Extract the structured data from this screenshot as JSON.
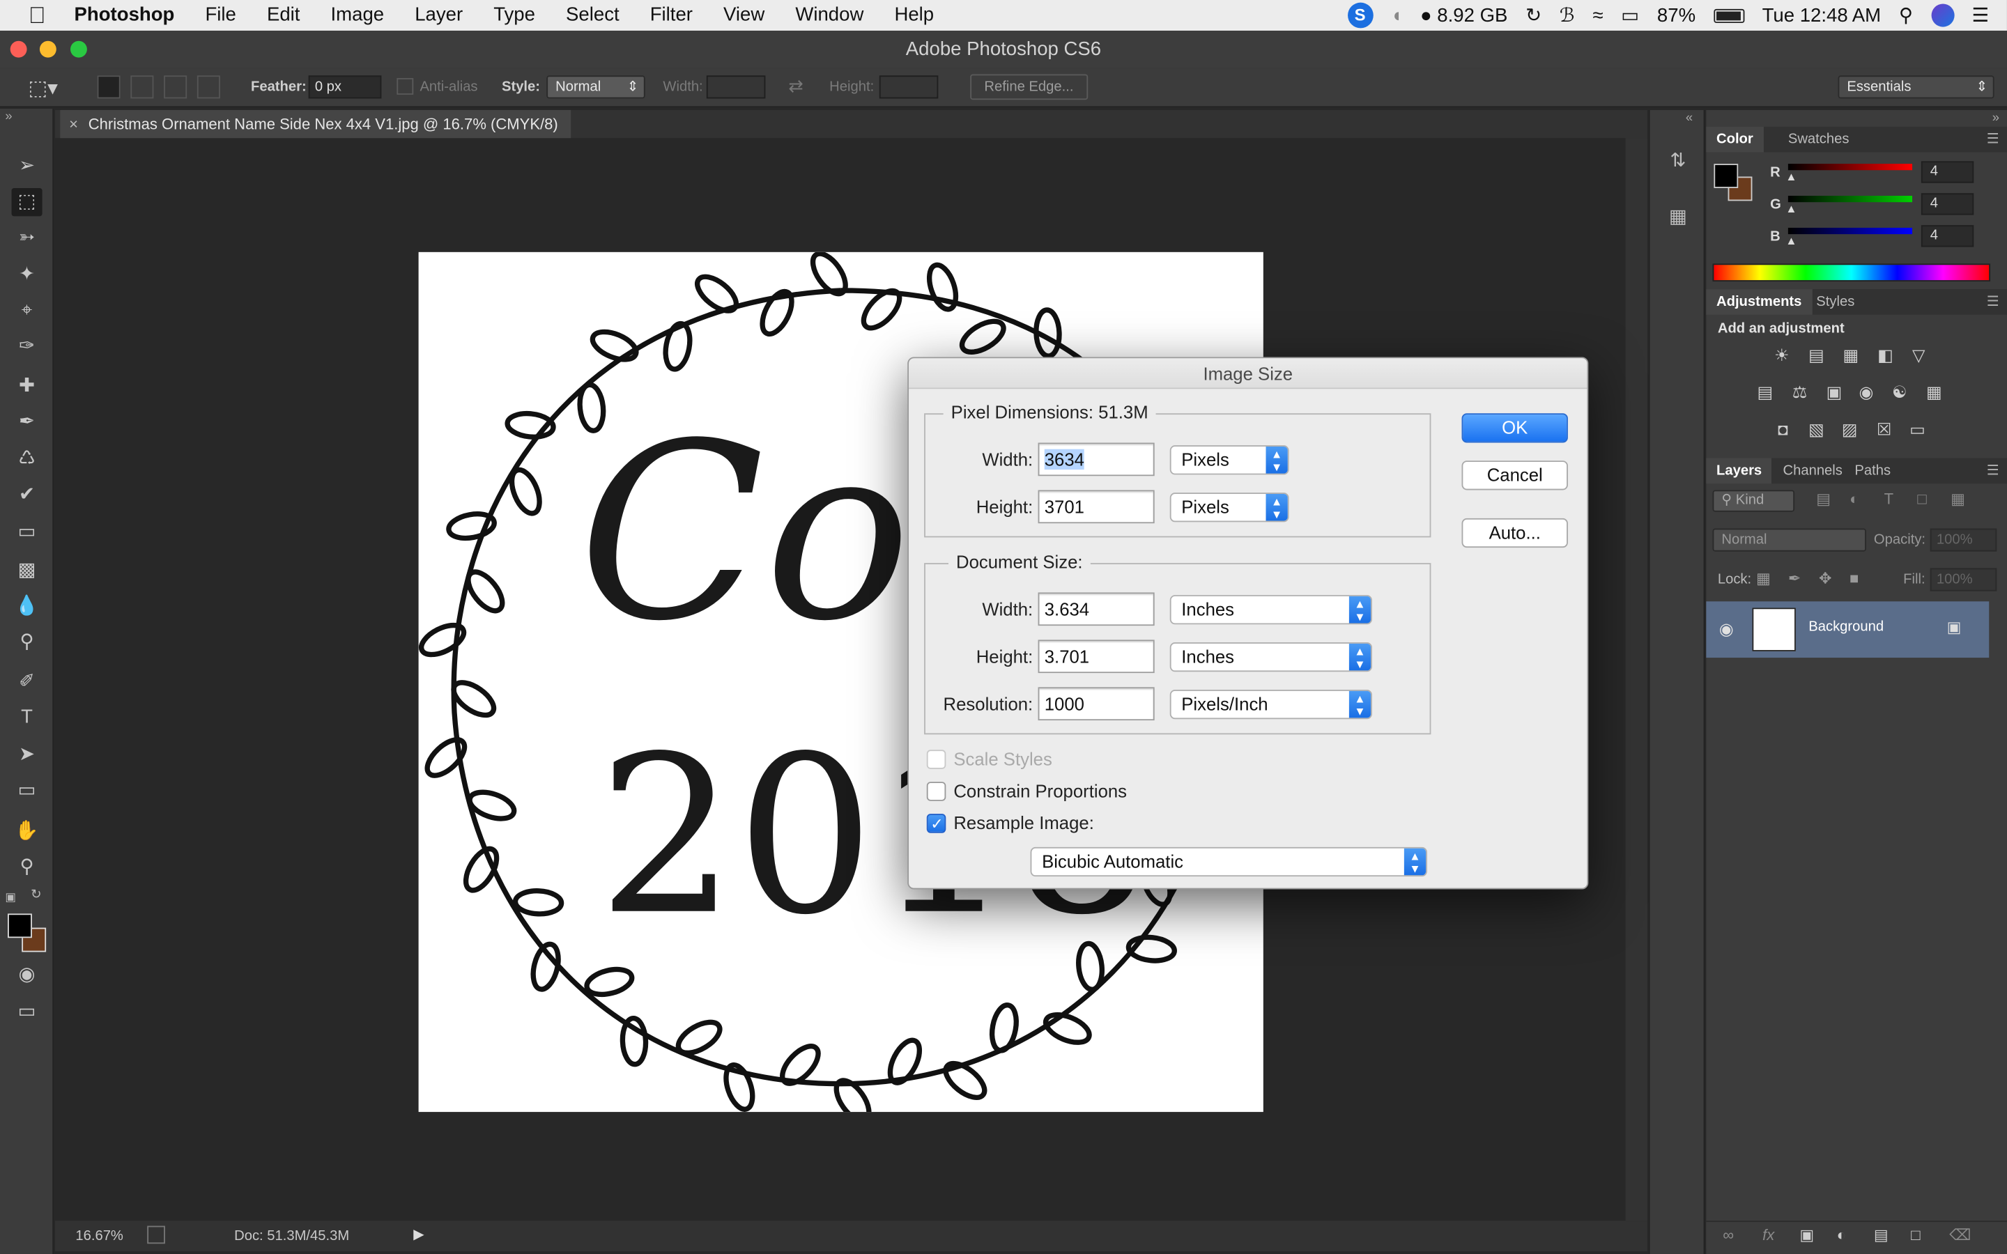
{
  "menubar": {
    "app_name": "Photoshop",
    "items": [
      "File",
      "Edit",
      "Image",
      "Layer",
      "Type",
      "Select",
      "Filter",
      "View",
      "Window",
      "Help"
    ],
    "memory": "8.92 GB",
    "battery": "87%",
    "battery_level": 0.87,
    "clock": "Tue 12:48 AM",
    "s_badge": "S"
  },
  "window": {
    "title": "Adobe Photoshop CS6"
  },
  "options": {
    "feather_label": "Feather:",
    "feather_value": "0 px",
    "antialias_label": "Anti-alias",
    "style_label": "Style:",
    "style_value": "Normal",
    "width_label": "Width:",
    "height_label": "Height:",
    "refine_edge": "Refine Edge...",
    "workspace": "Essentials"
  },
  "document": {
    "tab_title": "Christmas Ornament Name Side Nex 4x4 V1.jpg @ 16.7% (CMYK/8)",
    "canvas_text_top": "Cole",
    "canvas_text_bottom": "2018",
    "zoom": "16.67%",
    "doc_size": "Doc: 51.3M/45.3M"
  },
  "dialog": {
    "title": "Image Size",
    "pixel_dimensions_label": "Pixel Dimensions:  51.3M",
    "document_size_label": "Document Size:",
    "width_label": "Width:",
    "height_label": "Height:",
    "resolution_label": "Resolution:",
    "px_width": "3634",
    "px_height": "3701",
    "px_width_unit": "Pixels",
    "px_height_unit": "Pixels",
    "doc_width": "3.634",
    "doc_height": "3.701",
    "doc_width_unit": "Inches",
    "doc_height_unit": "Inches",
    "resolution": "1000",
    "resolution_unit": "Pixels/Inch",
    "scale_styles": "Scale Styles",
    "constrain_proportions": "Constrain Proportions",
    "resample_image": "Resample Image:",
    "resample_method": "Bicubic Automatic",
    "ok": "OK",
    "cancel": "Cancel",
    "auto": "Auto..."
  },
  "color_panel": {
    "tab_color": "Color",
    "tab_swatches": "Swatches",
    "r_label": "R",
    "g_label": "G",
    "b_label": "B",
    "r_value": "4",
    "g_value": "4",
    "b_value": "4",
    "foreground": "#000000",
    "background": "#6b3b1c"
  },
  "adjustments_panel": {
    "tab_adjustments": "Adjustments",
    "tab_styles": "Styles",
    "heading": "Add an adjustment"
  },
  "layers_panel": {
    "tab_layers": "Layers",
    "tab_channels": "Channels",
    "tab_paths": "Paths",
    "kind_filter": "Kind",
    "blend_mode": "Normal",
    "opacity_label": "Opacity:",
    "opacity_value": "100%",
    "lock_label": "Lock:",
    "fill_label": "Fill:",
    "fill_value": "100%",
    "layer_name": "Background"
  }
}
